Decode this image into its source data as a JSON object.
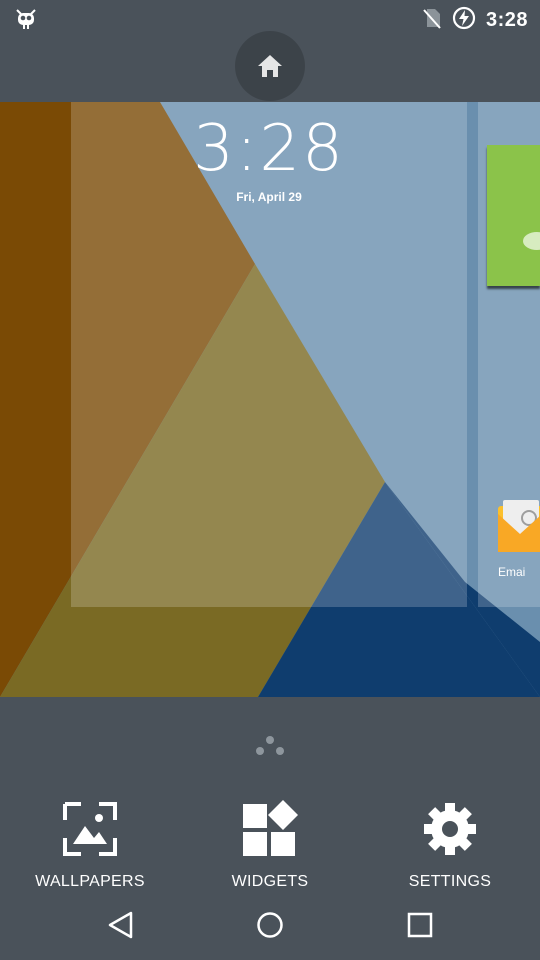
{
  "status_bar": {
    "time": "3:28",
    "icons": [
      "android-debug-icon",
      "no-sim-icon",
      "battery-charging-icon"
    ]
  },
  "clock_widget": {
    "time": "3:28",
    "date": "Fri, April 29"
  },
  "email_app": {
    "label": "Emai"
  },
  "overview_actions": {
    "wallpapers_label": "WALLPAPERS",
    "widgets_label": "WIDGETS",
    "settings_label": "SETTINGS"
  },
  "nav_icons": [
    "back-icon",
    "home-nav-icon",
    "recents-icon"
  ],
  "colors": {
    "background": "#4a525a",
    "wallpaper_blue": "#6a8fae",
    "wallpaper_orange": "#7a4a05",
    "wallpaper_olive": "#7a6a24",
    "widget_green": "#8bc34a"
  }
}
